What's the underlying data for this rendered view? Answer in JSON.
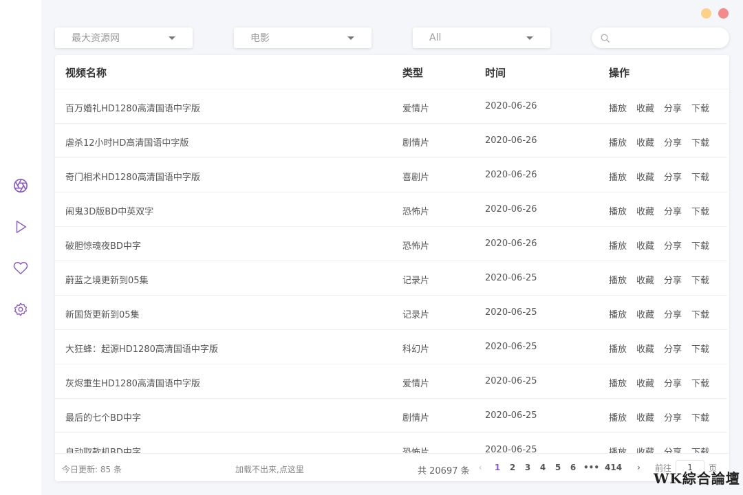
{
  "colors": {
    "accent": "#8a5cc5",
    "dot_yellow": "#fcd28a",
    "dot_red": "#f28c8c"
  },
  "sidebar": {
    "icons": [
      {
        "name": "aperture-icon"
      },
      {
        "name": "play-icon"
      },
      {
        "name": "heart-icon"
      },
      {
        "name": "settings-icon"
      }
    ]
  },
  "filters": {
    "source": "最大资源网",
    "category": "电影",
    "subcategory": "All"
  },
  "search": {
    "placeholder": "",
    "icon": "search-icon"
  },
  "table": {
    "headers": {
      "name": "视频名称",
      "type": "类型",
      "date": "时间",
      "ops": "操作"
    },
    "ops": {
      "play": "播放",
      "fav": "收藏",
      "share": "分享",
      "download": "下载"
    },
    "rows": [
      {
        "name": "百万婚礼HD1280高清国语中字版",
        "type": "爱情片",
        "date": "2020-06-26"
      },
      {
        "name": "虐杀12小时HD高清国语中字版",
        "type": "剧情片",
        "date": "2020-06-26"
      },
      {
        "name": "奇门相术HD1280高清国语中字版",
        "type": "喜剧片",
        "date": "2020-06-26"
      },
      {
        "name": "闹鬼3D版BD中英双字",
        "type": "恐怖片",
        "date": "2020-06-26"
      },
      {
        "name": "破胆惊魂夜BD中字",
        "type": "恐怖片",
        "date": "2020-06-26"
      },
      {
        "name": "蔚蓝之境更新到05集",
        "type": "记录片",
        "date": "2020-06-25"
      },
      {
        "name": "新国货更新到05集",
        "type": "记录片",
        "date": "2020-06-25"
      },
      {
        "name": "大狂蜂：起源HD1280高清国语中字版",
        "type": "科幻片",
        "date": "2020-06-25"
      },
      {
        "name": "灰烬重生HD1280高清国语中字版",
        "type": "爱情片",
        "date": "2020-06-25"
      },
      {
        "name": "最后的七个BD中字",
        "type": "剧情片",
        "date": "2020-06-25"
      },
      {
        "name": "自动取款机BD中字",
        "type": "恐怖片",
        "date": "2020-06-25"
      }
    ]
  },
  "footer": {
    "today": "今日更新: 85 条",
    "load_hint": "加载不出来,点这里",
    "total": "共 20697 条",
    "pages": [
      "1",
      "2",
      "3",
      "4",
      "5",
      "6"
    ],
    "current_page": "1",
    "ellipsis": "•••",
    "last_page": "414",
    "goto_prefix": "前往",
    "goto_value": "1",
    "goto_suffix": "页"
  },
  "watermark": "WK綜合論壇"
}
